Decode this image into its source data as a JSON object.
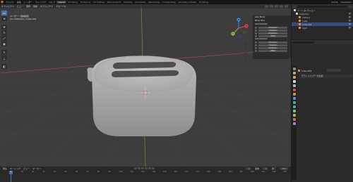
{
  "topbar": {
    "menus": [
      "ファイル",
      "編集",
      "レンダー",
      "ウィンドウ",
      "ヘルプ"
    ],
    "workspaces": [
      "Layout",
      "Modeling",
      "Sculpting",
      "UV Editing",
      "Texture Paint",
      "Shading",
      "Animation",
      "Rendering",
      "Compositing",
      "Geometry Nodes",
      "Scripting"
    ],
    "active_workspace": "Layout",
    "scene": "Scene",
    "view_layer": "ViewLayer"
  },
  "viewport": {
    "header_items": [
      "オブジェクト",
      "ビュー",
      "選択",
      "追加",
      "オブジェクト",
      "グローバル"
    ],
    "info_line1": "ユーザー・透視投影",
    "info_line2": "(1) Collection | Cube.002",
    "npanel": {
      "section1_title": "Auto Mirror",
      "section1_sub": "Mirror Tool",
      "section2_title": "Axis Direction",
      "rows1": [
        "X Direction",
        "Y Direction",
        "Z Direction",
        "Offset"
      ],
      "section3_title": "Axis Direction",
      "rows2": [
        "X Direction",
        "Y Direction",
        "Z Direction",
        "Offset"
      ]
    },
    "gizmo_axes": {
      "x": "X",
      "y": "Y",
      "z": "Z"
    },
    "colors": {
      "x_axis": "#f23b56",
      "y_axis": "#8ac241",
      "z_axis": "#3b86f2",
      "grid_bg": "#3d3d3d"
    }
  },
  "timeline": {
    "header_items": [
      "再生",
      "キーイング",
      "ビュー",
      "マーカー"
    ],
    "current_frame": "1",
    "start_label": "開始",
    "start": "1",
    "end_label": "終了",
    "end": "250",
    "ruler": [
      "0",
      "10",
      "20",
      "30",
      "40",
      "50",
      "60",
      "70",
      "80",
      "90",
      "100",
      "110",
      "120",
      "130",
      "140",
      "150",
      "160",
      "170",
      "180",
      "190",
      "200",
      "210",
      "220",
      "230",
      "240",
      "250"
    ]
  },
  "outliner": {
    "rows": [
      {
        "label": "シーンコレクション",
        "color": "#cfcfcf"
      },
      {
        "label": "Collection",
        "color": "#cfcfcf"
      },
      {
        "label": "Camera",
        "color": "#e8883a"
      },
      {
        "label": "Cube",
        "color": "#e8883a"
      },
      {
        "label": "Cube.002",
        "color": "#e8883a"
      },
      {
        "label": "Light",
        "color": "#e8883a"
      }
    ],
    "selected_index": 4,
    "vis_glyph": "👁"
  },
  "properties": {
    "object_name": "Cube.002",
    "section": "モディファイアーを追加"
  }
}
